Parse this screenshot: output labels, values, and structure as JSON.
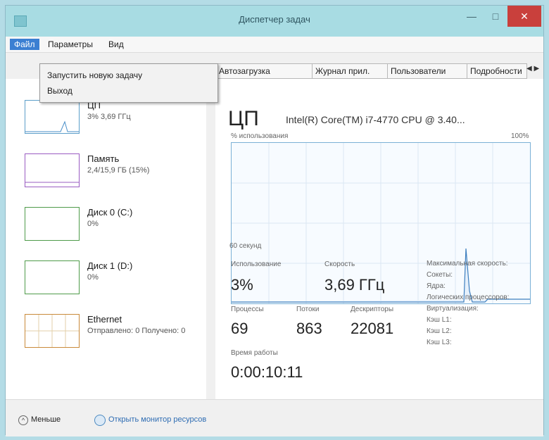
{
  "window": {
    "title": "Диспетчер задач"
  },
  "titlebar": {
    "min_icon": "—",
    "max_icon": "□",
    "close_icon": "✕"
  },
  "menu": [
    {
      "label": "Файл",
      "active": true
    },
    {
      "label": "Параметры"
    },
    {
      "label": "Вид"
    }
  ],
  "file_menu": [
    {
      "label": "Запустить новую задачу"
    },
    {
      "label": "Выход"
    }
  ],
  "tabs": [
    {
      "label": "Автозагрузка"
    },
    {
      "label": "Журнал прил."
    },
    {
      "label": "Пользователи"
    },
    {
      "label": "Подробности"
    }
  ],
  "sidebar": [
    {
      "title": "ЦП",
      "sub": "3% 3,69 ГГц"
    },
    {
      "title": "Память",
      "sub": "2,4/15,9 ГБ (15%)"
    },
    {
      "title": "Диск 0 (C:)",
      "sub": "0%"
    },
    {
      "title": "Диск 1 (D:)",
      "sub": "0%"
    },
    {
      "title": "Ethernet",
      "sub": "Отправлено: 0 Получено: 0"
    }
  ],
  "cpu": {
    "title": "ЦП",
    "model": "Intel(R) Core(TM) i7-4770 CPU @ 3.40...",
    "graph_label": "% использования",
    "graph_max": "100%",
    "graph_time": "60 секунд",
    "usage_label": "Использование",
    "usage_value": "3%",
    "speed_label": "Скорость",
    "speed_value": "3,69 ГГц",
    "processes_label": "Процессы",
    "processes_value": "69",
    "threads_label": "Потоки",
    "threads_value": "863",
    "handles_label": "Дескрипторы",
    "handles_value": "22081",
    "uptime_label": "Время работы",
    "uptime_value": "0:00:10:11",
    "right_lines": [
      "Максимальная скорость:",
      "Сокеты:",
      "Ядра:",
      "Логических процессоров:",
      "Виртуализация:",
      "Кэш L1:",
      "Кэш L2:",
      "Кэш L3:"
    ]
  },
  "status": {
    "less_label": "Меньше",
    "monitor_link": "Открыть монитор ресурсов"
  }
}
